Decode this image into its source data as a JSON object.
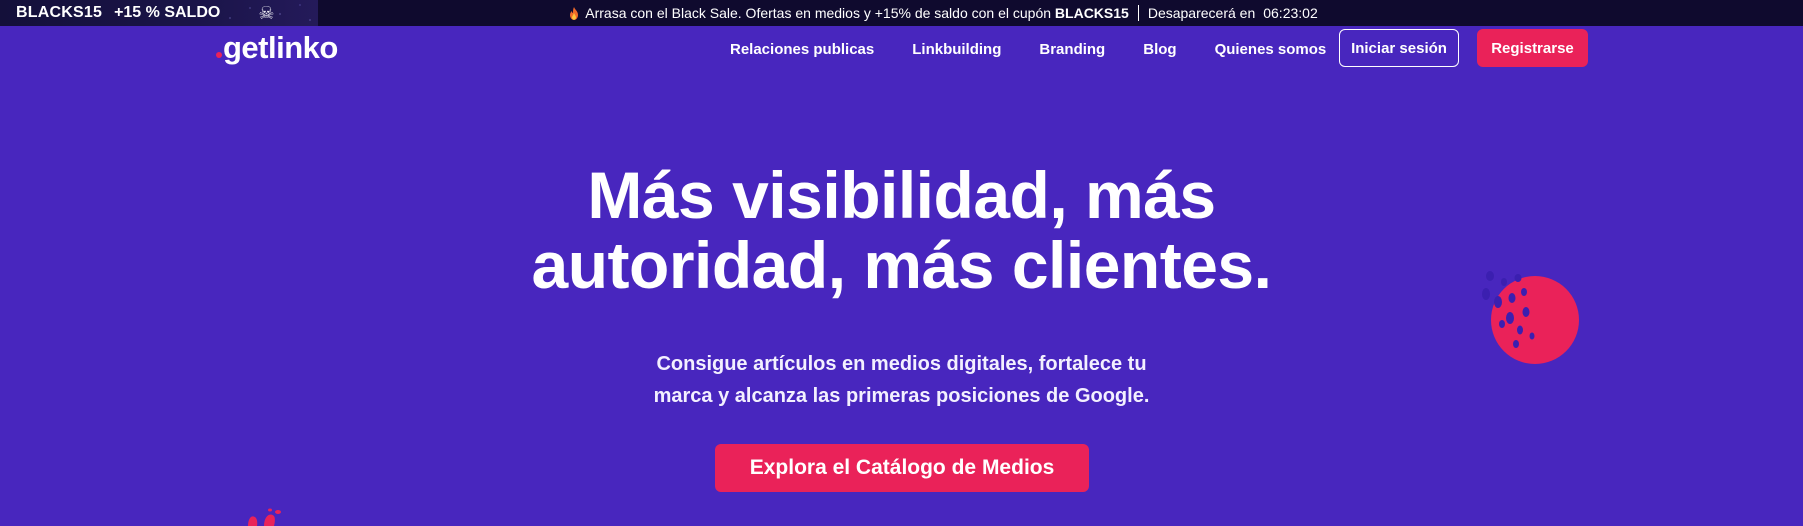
{
  "promo": {
    "code": "BLACKS15",
    "bonus": "+15 % SALDO",
    "skull_icon": "skull-crossbones-icon",
    "fire_icon": "fire-icon",
    "message_before": "Arrasa con el Black Sale. Ofertas en medios y +15% de saldo con el cupón ",
    "message_code": "BLACKS15",
    "countdown_label": "Desaparecerá en",
    "countdown_value": "06:23:02"
  },
  "header": {
    "logo": "getlinko",
    "nav": [
      {
        "label": "Relaciones publicas"
      },
      {
        "label": "Linkbuilding"
      },
      {
        "label": "Branding"
      },
      {
        "label": "Blog"
      },
      {
        "label": "Quienes somos"
      }
    ],
    "login_label": "Iniciar sesión",
    "register_label": "Registrarse"
  },
  "hero": {
    "title_line1": "Más visibilidad, más",
    "title_line2": "autoridad, más clientes.",
    "subtitle_line1": "Consigue artículos en medios digitales, fortalece tu",
    "subtitle_line2": "marca y alcanza las primeras posiciones de Google.",
    "cta_label": "Explora el Catálogo de Medios"
  },
  "colors": {
    "background": "#4826be",
    "promo_bar": "#0f0a2e",
    "accent": "#ea2259",
    "text": "#ffffff"
  }
}
